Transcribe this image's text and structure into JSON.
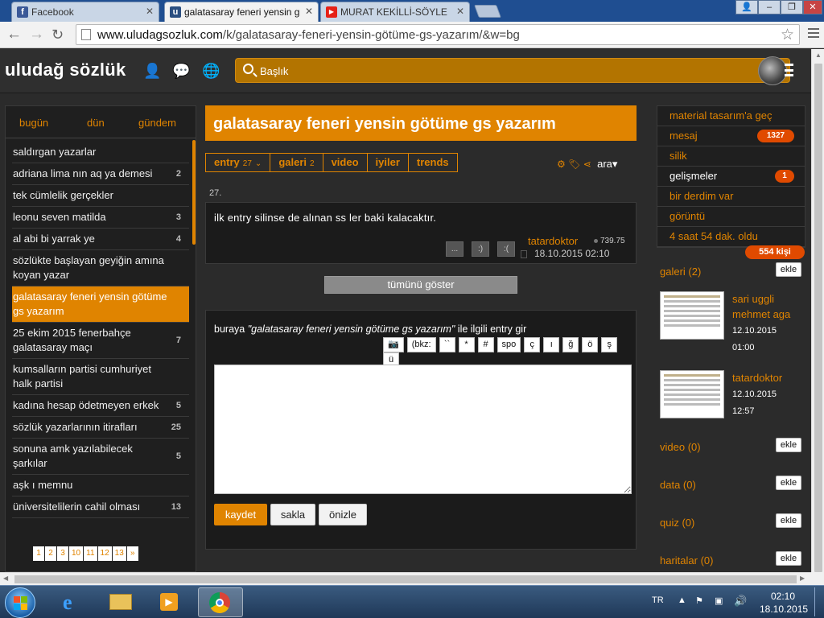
{
  "browser": {
    "tabs": [
      {
        "title": "Facebook",
        "icon": "facebook-icon",
        "color": "#3b5998",
        "letter": "f"
      },
      {
        "title": "galatasaray feneri yensin g",
        "icon": "uludag-icon",
        "color": "#2b4f81",
        "letter": "u"
      },
      {
        "title": "MURAT KEKİLLİ-SÖYLE",
        "icon": "youtube-icon",
        "color": "#e62117",
        "letter": "▶"
      }
    ],
    "url_domain": "www.uludagsozluk.com",
    "url_path": "/k/galatasaray-feneri-yensin-götüme-gs-yazarım/&w=bg"
  },
  "header": {
    "logo": "uludağ sözlük",
    "search_placeholder": "Başlık"
  },
  "left": {
    "tabs": [
      "bugün",
      "dün",
      "gündem"
    ],
    "topics": [
      {
        "title": "saldırgan yazarlar",
        "count": ""
      },
      {
        "title": "adriana lima nın aq ya demesi",
        "count": "2"
      },
      {
        "title": "tek cümlelik gerçekler",
        "count": ""
      },
      {
        "title": "leonu seven matilda",
        "count": "3"
      },
      {
        "title": "al abi bi yarrak ye",
        "count": "4"
      },
      {
        "title": "sözlükte başlayan geyiğin amına koyan yazar",
        "count": ""
      },
      {
        "title": "galatasaray feneri yensin götüme gs yazarım",
        "count": ""
      },
      {
        "title": "25 ekim 2015 fenerbahçe galatasaray maçı",
        "count": "7"
      },
      {
        "title": "kumsalların partisi cumhuriyet halk partisi",
        "count": ""
      },
      {
        "title": "kadına hesap ödetmeyen erkek",
        "count": "5"
      },
      {
        "title": "sözlük yazarlarının itirafları",
        "count": "25"
      },
      {
        "title": "sonuna amk yazılabilecek şarkılar",
        "count": "5"
      },
      {
        "title": "aşk ı memnu",
        "count": ""
      },
      {
        "title": "üniversitelilerin cahil olması",
        "count": "13"
      }
    ],
    "active_index": 6,
    "pages": [
      "1",
      "2",
      "3",
      "10",
      "11",
      "12",
      "13",
      "»"
    ]
  },
  "main": {
    "title": "galatasaray feneri yensin götüme gs yazarım",
    "tabs": [
      {
        "label": "entry",
        "badge": "27"
      },
      {
        "label": "galeri",
        "badge": "2"
      },
      {
        "label": "video",
        "badge": ""
      },
      {
        "label": "iyiler",
        "badge": ""
      },
      {
        "label": "trends",
        "badge": ""
      }
    ],
    "ara": "ara",
    "entry": {
      "number": "27.",
      "text": "ilk entry silinse de alınan ss ler baki kalacaktır.",
      "author": "tatardoktor",
      "karma": "739.75",
      "date": "18.10.2015 02:10",
      "reactions": [
        "...",
        ":)",
        ":("
      ]
    },
    "show_all": "tümünü göster",
    "editor": {
      "prompt_before": "buraya ",
      "prompt_title": "\"galatasaray feneri yensin götüme gs yazarım\"",
      "prompt_after": " ile ilgili entry gir",
      "format_buttons": [
        "(bkz:",
        "``",
        "*",
        "#",
        "spo",
        "ç",
        "ı",
        "ğ",
        "ö",
        "ş",
        "ü"
      ],
      "submit": "kaydet",
      "save": "sakla",
      "preview": "önizle"
    }
  },
  "right": {
    "menu": [
      {
        "label": "material tasarım'a geç",
        "badge": "",
        "style": "orange"
      },
      {
        "label": "mesaj",
        "badge": "1327",
        "style": "orange"
      },
      {
        "label": "silik",
        "badge": "",
        "style": "orange"
      },
      {
        "label": "gelişmeler",
        "badge": "1",
        "style": "white"
      },
      {
        "label": "bir derdim var",
        "badge": "",
        "style": "orange"
      },
      {
        "label": "görüntü",
        "badge": "",
        "style": "orange"
      },
      {
        "label": "4 saat 54 dak. oldu",
        "badge": "",
        "style": "orange"
      }
    ],
    "online": "554 kişi",
    "galeri_label": "galeri (2)",
    "galeri": [
      {
        "name": "sari uggli mehmet aga",
        "date": "12.10.2015",
        "time": "01:00"
      },
      {
        "name": "tatardoktor",
        "date": "12.10.2015",
        "time": "12:57"
      }
    ],
    "sections": [
      "video (0)",
      "data (0)",
      "quiz (0)",
      "haritalar (0)"
    ],
    "add": "ekle"
  },
  "taskbar": {
    "lang": "TR",
    "time": "02:10",
    "date": "18.10.2015"
  },
  "colors": {
    "accent": "#e08400",
    "badge": "#e04a00"
  }
}
